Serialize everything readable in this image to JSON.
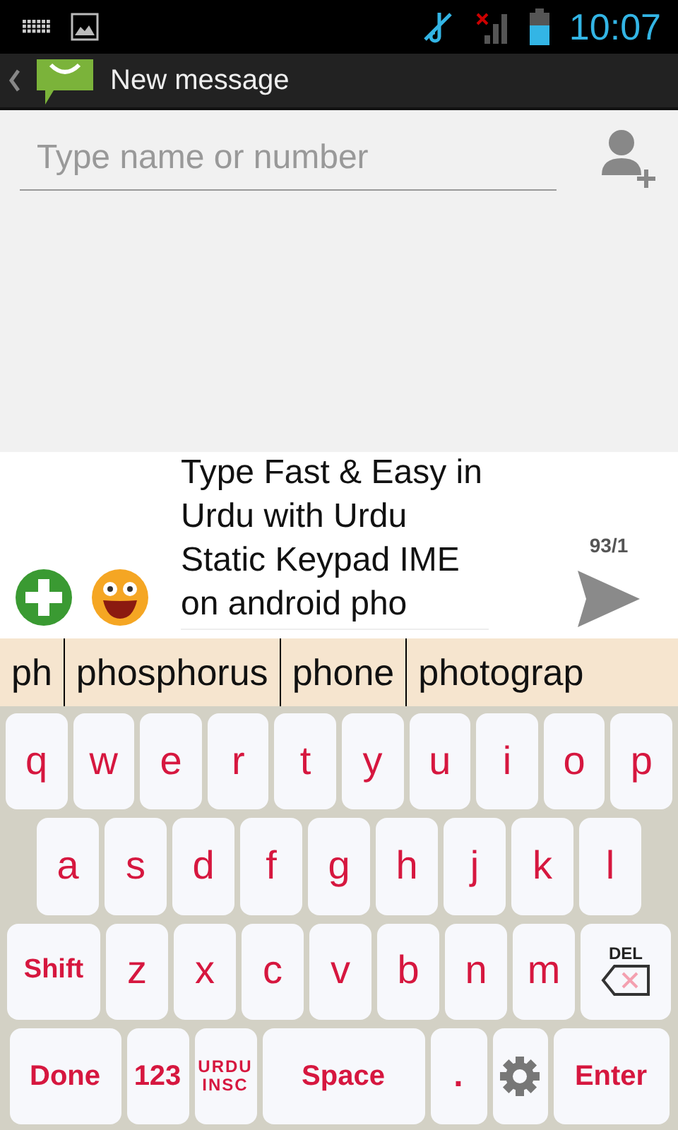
{
  "status_bar": {
    "time": "10:07"
  },
  "action_bar": {
    "title": "New message"
  },
  "recipient": {
    "placeholder": "Type name or number"
  },
  "compose": {
    "text": "Type Fast & Easy in Urdu with Urdu Static Keypad IME on android pho",
    "counter": "93/1"
  },
  "suggestions": [
    {
      "text": "ph",
      "selected": false
    },
    {
      "text": "phosphorus",
      "selected": false
    },
    {
      "text": "phone",
      "selected": false
    },
    {
      "text": "photograp",
      "selected": false
    }
  ],
  "keyboard": {
    "rows": [
      {
        "keys": [
          {
            "kind": "letter",
            "label": "q"
          },
          {
            "kind": "letter",
            "label": "w"
          },
          {
            "kind": "letter",
            "label": "e"
          },
          {
            "kind": "letter",
            "label": "r"
          },
          {
            "kind": "letter",
            "label": "t"
          },
          {
            "kind": "letter",
            "label": "y"
          },
          {
            "kind": "letter",
            "label": "u"
          },
          {
            "kind": "letter",
            "label": "i"
          },
          {
            "kind": "letter",
            "label": "o"
          },
          {
            "kind": "letter",
            "label": "p"
          }
        ]
      },
      {
        "keys": [
          {
            "kind": "letter",
            "label": "a"
          },
          {
            "kind": "letter",
            "label": "s"
          },
          {
            "kind": "letter",
            "label": "d"
          },
          {
            "kind": "letter",
            "label": "f"
          },
          {
            "kind": "letter",
            "label": "g"
          },
          {
            "kind": "letter",
            "label": "h"
          },
          {
            "kind": "letter",
            "label": "j"
          },
          {
            "kind": "letter",
            "label": "k"
          },
          {
            "kind": "letter",
            "label": "l"
          }
        ]
      },
      {
        "keys": [
          {
            "kind": "shift",
            "label": "Shift"
          },
          {
            "kind": "letter",
            "label": "z"
          },
          {
            "kind": "letter",
            "label": "x"
          },
          {
            "kind": "letter",
            "label": "c"
          },
          {
            "kind": "letter",
            "label": "v"
          },
          {
            "kind": "letter",
            "label": "b"
          },
          {
            "kind": "letter",
            "label": "n"
          },
          {
            "kind": "letter",
            "label": "m"
          },
          {
            "kind": "delete",
            "label": "DEL"
          }
        ]
      },
      {
        "keys": [
          {
            "kind": "done",
            "label": "Done"
          },
          {
            "kind": "numbers",
            "label": "123"
          },
          {
            "kind": "language",
            "label": "URDU INSC"
          },
          {
            "kind": "space",
            "label": "Space"
          },
          {
            "kind": "period",
            "label": "."
          },
          {
            "kind": "settings"
          },
          {
            "kind": "enter",
            "label": "Enter"
          }
        ]
      }
    ]
  }
}
